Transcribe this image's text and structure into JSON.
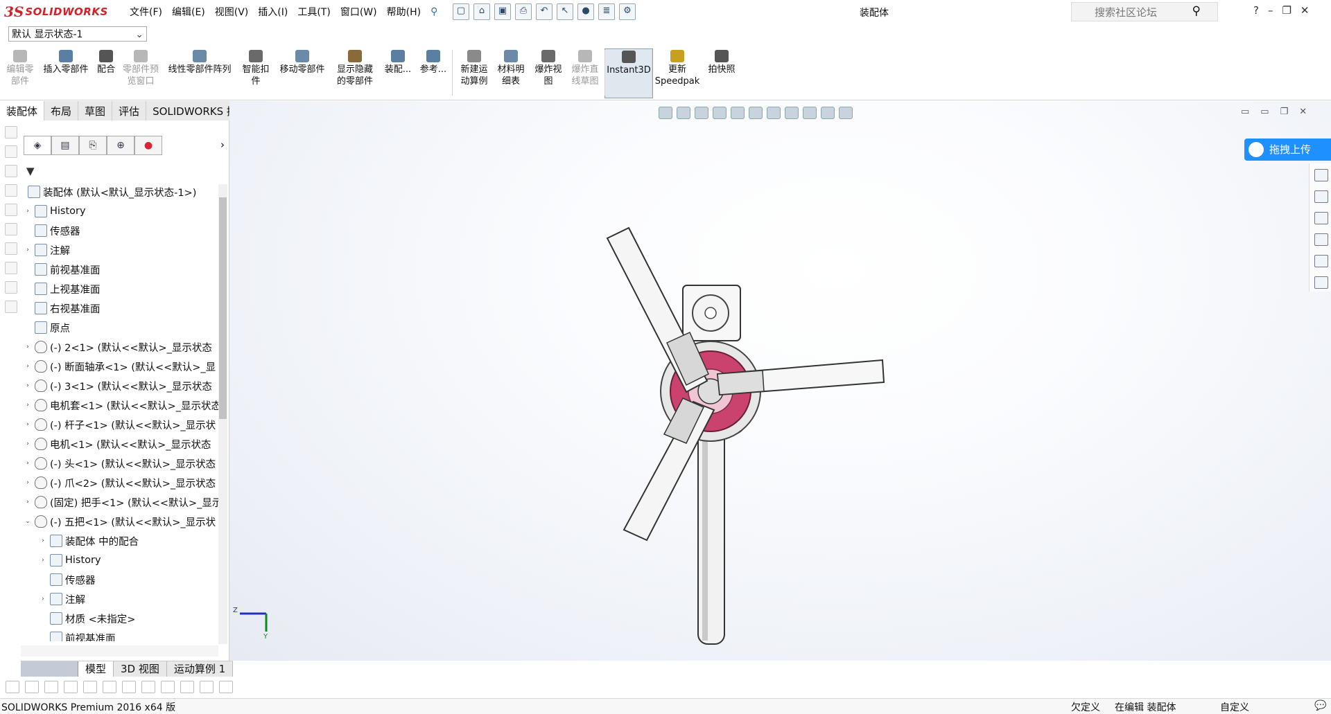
{
  "app": {
    "brand_prefix": "3S",
    "brand_name": "SOLIDWORKS"
  },
  "menu": [
    "文件(F)",
    "编辑(E)",
    "视图(V)",
    "插入(I)",
    "工具(T)",
    "窗口(W)",
    "帮助(H)"
  ],
  "doc_title": "装配体",
  "search": {
    "placeholder": "搜索社区论坛"
  },
  "window_controls": {
    "help": "?",
    "minimize": "–",
    "restore": "❐",
    "close": "✕"
  },
  "config_select": {
    "value": "默认 显示状态-1"
  },
  "commands": [
    {
      "label": "编辑零\n部件",
      "disabled": true
    },
    {
      "label": "插入零部件",
      "disabled": false
    },
    {
      "label": "配合",
      "disabled": false
    },
    {
      "label": "零部件预\n览窗口",
      "disabled": true
    },
    {
      "label": "线性零部件阵列",
      "disabled": false
    },
    {
      "label": "智能扣\n件",
      "disabled": false
    },
    {
      "label": "移动零部件",
      "disabled": false
    },
    {
      "label": "显示隐藏\n的零部件",
      "disabled": false
    },
    {
      "label": "装配...",
      "disabled": false
    },
    {
      "label": "参考...",
      "disabled": false
    },
    {
      "label": "新建运\n动算例",
      "disabled": false
    },
    {
      "label": "材料明\n细表",
      "disabled": false
    },
    {
      "label": "爆炸视\n图",
      "disabled": false
    },
    {
      "label": "爆炸直\n线草图",
      "disabled": true
    },
    {
      "label": "Instant3D",
      "disabled": false
    },
    {
      "label": "更新\nSpeedpak",
      "disabled": false
    },
    {
      "label": "拍快照",
      "disabled": false
    }
  ],
  "tabs": [
    "装配体",
    "布局",
    "草图",
    "评估",
    "SOLIDWORKS 插件"
  ],
  "fm_filter": "▼",
  "tree": [
    {
      "text": "装配体  (默认<默认_显示状态-1>)",
      "level": 0,
      "twisty": ""
    },
    {
      "text": "History",
      "level": 1,
      "twisty": "›"
    },
    {
      "text": "传感器",
      "level": 1,
      "twisty": ""
    },
    {
      "text": "注解",
      "level": 1,
      "twisty": "›"
    },
    {
      "text": "前视基准面",
      "level": 1,
      "twisty": ""
    },
    {
      "text": "上视基准面",
      "level": 1,
      "twisty": ""
    },
    {
      "text": "右视基准面",
      "level": 1,
      "twisty": ""
    },
    {
      "text": "原点",
      "level": 1,
      "twisty": ""
    },
    {
      "text": "(-) 2<1> (默认<<默认>_显示状态",
      "level": 1,
      "twisty": "›"
    },
    {
      "text": "(-) 断面轴承<1> (默认<<默认>_显",
      "level": 1,
      "twisty": "›"
    },
    {
      "text": "(-) 3<1> (默认<<默认>_显示状态",
      "level": 1,
      "twisty": "›"
    },
    {
      "text": "电机套<1> (默认<<默认>_显示状态",
      "level": 1,
      "twisty": "›"
    },
    {
      "text": "(-) 杆子<1> (默认<<默认>_显示状",
      "level": 1,
      "twisty": "›"
    },
    {
      "text": "电机<1> (默认<<默认>_显示状态",
      "level": 1,
      "twisty": "›"
    },
    {
      "text": "(-) 头<1> (默认<<默认>_显示状态",
      "level": 1,
      "twisty": "›"
    },
    {
      "text": "(-) 爪<2> (默认<<默认>_显示状态",
      "level": 1,
      "twisty": "›"
    },
    {
      "text": "(固定) 把手<1> (默认<<默认>_显示",
      "level": 1,
      "twisty": "›"
    },
    {
      "text": "(-) 五把<1> (默认<<默认>_显示状",
      "level": 1,
      "twisty": "⌄"
    },
    {
      "text": "装配体 中的配合",
      "level": 2,
      "twisty": "›"
    },
    {
      "text": "History",
      "level": 2,
      "twisty": "›"
    },
    {
      "text": "传感器",
      "level": 2,
      "twisty": ""
    },
    {
      "text": "注解",
      "level": 2,
      "twisty": "›"
    },
    {
      "text": "材质 <未指定>",
      "level": 2,
      "twisty": ""
    },
    {
      "text": "前视基准面",
      "level": 2,
      "twisty": ""
    }
  ],
  "upload_button": "拖拽上传",
  "bottom_tabs": [
    "模型",
    "3D 视图",
    "运动算例 1"
  ],
  "status": {
    "product": "SOLIDWORKS Premium 2016 x64 版",
    "underdefined": "欠定义",
    "editing": "在编辑 装配体",
    "custom": "自定义"
  },
  "colors": {
    "brand": "#d2232a",
    "accent_pink": "#d6507a",
    "upload_blue": "#1e90ff"
  }
}
